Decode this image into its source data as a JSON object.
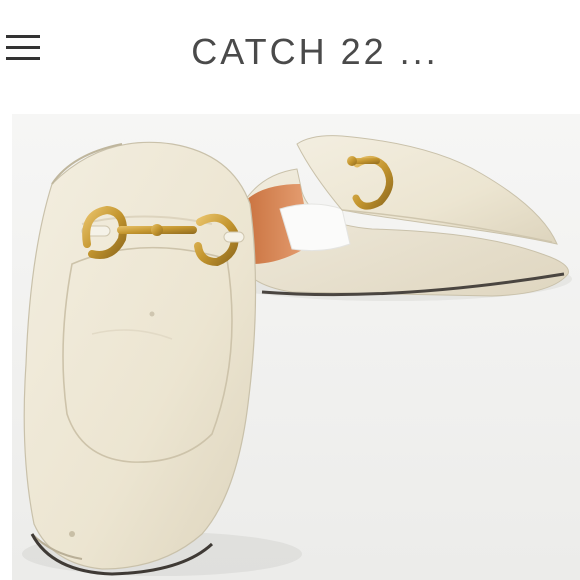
{
  "header": {
    "title": "CATCH 22 ..."
  },
  "icons": {
    "menu": "hamburger-menu-icon"
  },
  "photo": {
    "subject": "product-photo"
  },
  "colors": {
    "header_text": "#4a4a4a",
    "leather": "#efe9d8",
    "hardware": "#c79a3a",
    "lining": "#d98a5a"
  }
}
